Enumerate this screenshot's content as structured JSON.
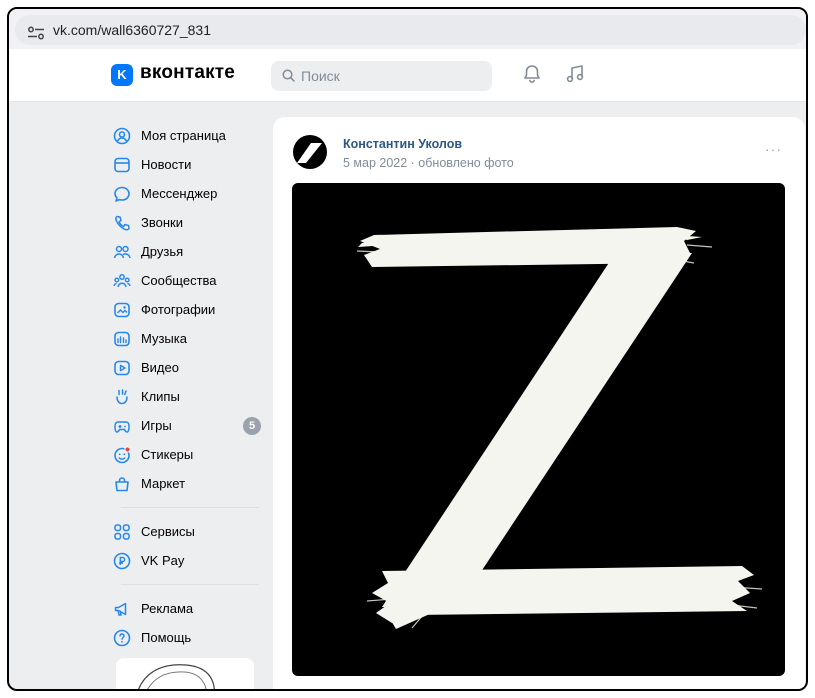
{
  "browser": {
    "url": "vk.com/wall6360727_831"
  },
  "header": {
    "logo_mark": "K",
    "logo_text": "вконтакте",
    "search_placeholder": "Поиск"
  },
  "sidebar": {
    "items": [
      {
        "label": "Моя страница",
        "icon": "user-circle-icon"
      },
      {
        "label": "Новости",
        "icon": "news-icon"
      },
      {
        "label": "Мессенджер",
        "icon": "message-icon"
      },
      {
        "label": "Звонки",
        "icon": "phone-icon"
      },
      {
        "label": "Друзья",
        "icon": "friends-icon"
      },
      {
        "label": "Сообщества",
        "icon": "communities-icon"
      },
      {
        "label": "Фотографии",
        "icon": "photos-icon"
      },
      {
        "label": "Музыка",
        "icon": "music-icon"
      },
      {
        "label": "Видео",
        "icon": "video-icon"
      },
      {
        "label": "Клипы",
        "icon": "clips-icon"
      },
      {
        "label": "Игры",
        "icon": "games-icon",
        "badge": "5"
      },
      {
        "label": "Стикеры",
        "icon": "stickers-icon"
      },
      {
        "label": "Маркет",
        "icon": "market-icon"
      }
    ],
    "items2": [
      {
        "label": "Сервисы",
        "icon": "services-icon"
      },
      {
        "label": "VK Pay",
        "icon": "vkpay-icon"
      }
    ],
    "items3": [
      {
        "label": "Реклама",
        "icon": "megaphone-icon"
      },
      {
        "label": "Помощь",
        "icon": "help-icon"
      }
    ]
  },
  "post": {
    "author": "Константин Уколов",
    "meta": "5 мар 2022 · обновлено фото",
    "more": "···"
  },
  "colors": {
    "accent": "#0077ff",
    "link": "#2a5885",
    "muted": "#818c99",
    "icon": "#2688eb"
  }
}
